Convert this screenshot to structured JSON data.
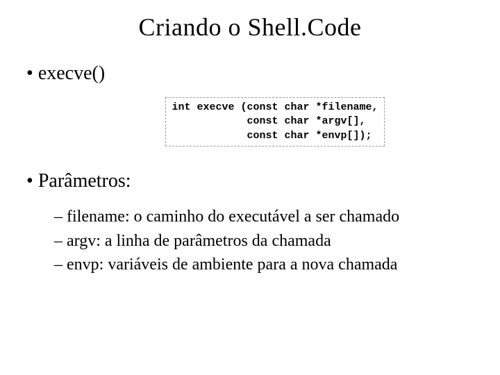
{
  "title": "Criando o Shell.Code",
  "bullet1": "execve()",
  "code": "int execve (const char *filename,\n            const char *argv[],\n            const char *envp[]);",
  "bullet2": "Parâmetros:",
  "params": {
    "p1": "filename: o caminho do executável a ser chamado",
    "p2": "argv: a linha de parâmetros da chamada",
    "p3": "envp: variáveis de ambiente para a nova chamada"
  }
}
